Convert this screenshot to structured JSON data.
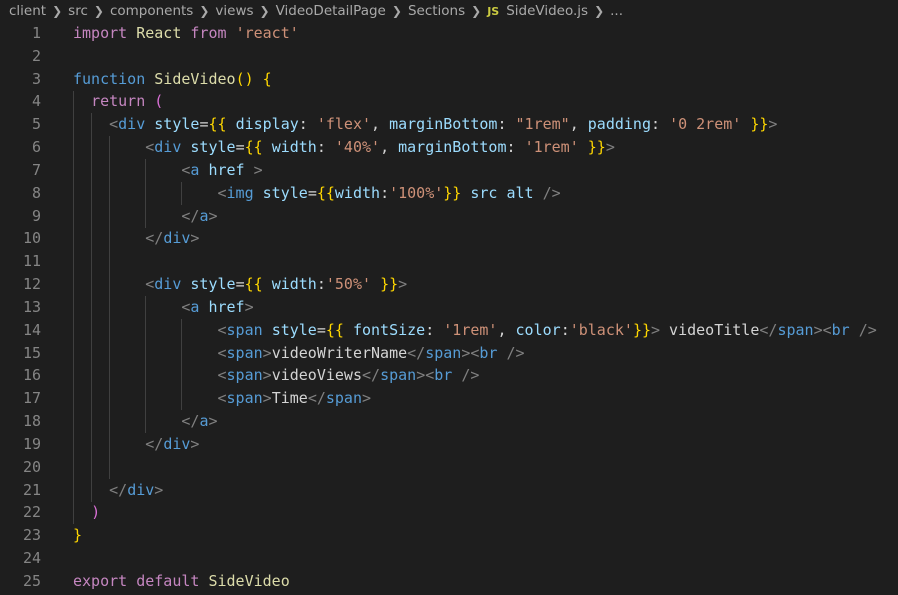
{
  "breadcrumb": {
    "items": [
      "client",
      "src",
      "components",
      "views",
      "VideoDetailPage",
      "Sections"
    ],
    "file_icon": "JS",
    "file_name": "SideVideo.js",
    "ellipsis": "..."
  },
  "code": {
    "line_numbers": [
      "1",
      "2",
      "3",
      "4",
      "5",
      "6",
      "7",
      "8",
      "9",
      "10",
      "11",
      "12",
      "13",
      "14",
      "15",
      "16",
      "17",
      "18",
      "19",
      "20",
      "21",
      "22",
      "23",
      "24",
      "25"
    ],
    "lines": [
      [
        [
          "kw",
          "import"
        ],
        [
          "pl",
          " "
        ],
        [
          "fn",
          "React"
        ],
        [
          "pl",
          " "
        ],
        [
          "kw",
          "from"
        ],
        [
          "pl",
          " "
        ],
        [
          "str",
          "'react'"
        ]
      ],
      [],
      [
        [
          "kwb",
          "function"
        ],
        [
          "pl",
          " "
        ],
        [
          "fn",
          "SideVideo"
        ],
        [
          "cb",
          "()"
        ],
        [
          "pl",
          " "
        ],
        [
          "cb",
          "{"
        ]
      ],
      [
        [
          "pl",
          "  "
        ],
        [
          "kw",
          "return"
        ],
        [
          "pl",
          " "
        ],
        [
          "cb2",
          "("
        ]
      ],
      [
        [
          "pl",
          "    "
        ],
        [
          "br",
          "<"
        ],
        [
          "tag",
          "div"
        ],
        [
          "pl",
          " "
        ],
        [
          "attr",
          "style"
        ],
        [
          "pl",
          "="
        ],
        [
          "cb",
          "{{"
        ],
        [
          "pl",
          " "
        ],
        [
          "attr",
          "display"
        ],
        [
          "pl",
          ": "
        ],
        [
          "str",
          "'flex'"
        ],
        [
          "pl",
          ", "
        ],
        [
          "attr",
          "marginBottom"
        ],
        [
          "pl",
          ": "
        ],
        [
          "str",
          "\"1rem\""
        ],
        [
          "pl",
          ", "
        ],
        [
          "attr",
          "padding"
        ],
        [
          "pl",
          ": "
        ],
        [
          "str",
          "'0 2rem'"
        ],
        [
          "pl",
          " "
        ],
        [
          "cb",
          "}}"
        ],
        [
          "br",
          ">"
        ]
      ],
      [
        [
          "pl",
          "        "
        ],
        [
          "br",
          "<"
        ],
        [
          "tag",
          "div"
        ],
        [
          "pl",
          " "
        ],
        [
          "attr",
          "style"
        ],
        [
          "pl",
          "="
        ],
        [
          "cb",
          "{{"
        ],
        [
          "pl",
          " "
        ],
        [
          "attr",
          "width"
        ],
        [
          "pl",
          ": "
        ],
        [
          "str",
          "'40%'"
        ],
        [
          "pl",
          ", "
        ],
        [
          "attr",
          "marginBottom"
        ],
        [
          "pl",
          ": "
        ],
        [
          "str",
          "'1rem'"
        ],
        [
          "pl",
          " "
        ],
        [
          "cb",
          "}}"
        ],
        [
          "br",
          ">"
        ]
      ],
      [
        [
          "pl",
          "            "
        ],
        [
          "br",
          "<"
        ],
        [
          "tag",
          "a"
        ],
        [
          "pl",
          " "
        ],
        [
          "attr",
          "href"
        ],
        [
          "pl",
          " "
        ],
        [
          "br",
          ">"
        ]
      ],
      [
        [
          "pl",
          "                "
        ],
        [
          "br",
          "<"
        ],
        [
          "tag",
          "img"
        ],
        [
          "pl",
          " "
        ],
        [
          "attr",
          "style"
        ],
        [
          "pl",
          "="
        ],
        [
          "cb",
          "{{"
        ],
        [
          "attr",
          "width"
        ],
        [
          "pl",
          ":"
        ],
        [
          "str",
          "'100%'"
        ],
        [
          "cb",
          "}}"
        ],
        [
          "pl",
          " "
        ],
        [
          "attr",
          "src"
        ],
        [
          "pl",
          " "
        ],
        [
          "attr",
          "alt"
        ],
        [
          "pl",
          " "
        ],
        [
          "br",
          "/>"
        ]
      ],
      [
        [
          "pl",
          "            "
        ],
        [
          "br",
          "</"
        ],
        [
          "tag",
          "a"
        ],
        [
          "br",
          ">"
        ]
      ],
      [
        [
          "pl",
          "        "
        ],
        [
          "br",
          "</"
        ],
        [
          "tag",
          "div"
        ],
        [
          "br",
          ">"
        ]
      ],
      [],
      [
        [
          "pl",
          "        "
        ],
        [
          "br",
          "<"
        ],
        [
          "tag",
          "div"
        ],
        [
          "pl",
          " "
        ],
        [
          "attr",
          "style"
        ],
        [
          "pl",
          "="
        ],
        [
          "cb",
          "{{"
        ],
        [
          "pl",
          " "
        ],
        [
          "attr",
          "width"
        ],
        [
          "pl",
          ":"
        ],
        [
          "str",
          "'50%'"
        ],
        [
          "pl",
          " "
        ],
        [
          "cb",
          "}}"
        ],
        [
          "br",
          ">"
        ]
      ],
      [
        [
          "pl",
          "            "
        ],
        [
          "br",
          "<"
        ],
        [
          "tag",
          "a"
        ],
        [
          "pl",
          " "
        ],
        [
          "attr",
          "href"
        ],
        [
          "br",
          ">"
        ]
      ],
      [
        [
          "pl",
          "                "
        ],
        [
          "br",
          "<"
        ],
        [
          "tag",
          "span"
        ],
        [
          "pl",
          " "
        ],
        [
          "attr",
          "style"
        ],
        [
          "pl",
          "="
        ],
        [
          "cb",
          "{{"
        ],
        [
          "pl",
          " "
        ],
        [
          "attr",
          "fontSize"
        ],
        [
          "pl",
          ": "
        ],
        [
          "str",
          "'1rem'"
        ],
        [
          "pl",
          ", "
        ],
        [
          "attr",
          "color"
        ],
        [
          "pl",
          ":"
        ],
        [
          "str",
          "'black'"
        ],
        [
          "cb",
          "}}"
        ],
        [
          "br",
          ">"
        ],
        [
          "pl",
          " videoTitle"
        ],
        [
          "br",
          "</"
        ],
        [
          "tag",
          "span"
        ],
        [
          "br",
          "><"
        ],
        [
          "tag",
          "br"
        ],
        [
          "pl",
          " "
        ],
        [
          "br",
          "/>"
        ]
      ],
      [
        [
          "pl",
          "                "
        ],
        [
          "br",
          "<"
        ],
        [
          "tag",
          "span"
        ],
        [
          "br",
          ">"
        ],
        [
          "pl",
          "videoWriterName"
        ],
        [
          "br",
          "</"
        ],
        [
          "tag",
          "span"
        ],
        [
          "br",
          "><"
        ],
        [
          "tag",
          "br"
        ],
        [
          "pl",
          " "
        ],
        [
          "br",
          "/>"
        ]
      ],
      [
        [
          "pl",
          "                "
        ],
        [
          "br",
          "<"
        ],
        [
          "tag",
          "span"
        ],
        [
          "br",
          ">"
        ],
        [
          "pl",
          "videoViews"
        ],
        [
          "br",
          "</"
        ],
        [
          "tag",
          "span"
        ],
        [
          "br",
          "><"
        ],
        [
          "tag",
          "br"
        ],
        [
          "pl",
          " "
        ],
        [
          "br",
          "/>"
        ]
      ],
      [
        [
          "pl",
          "                "
        ],
        [
          "br",
          "<"
        ],
        [
          "tag",
          "span"
        ],
        [
          "br",
          ">"
        ],
        [
          "pl",
          "Time"
        ],
        [
          "br",
          "</"
        ],
        [
          "tag",
          "span"
        ],
        [
          "br",
          ">"
        ]
      ],
      [
        [
          "pl",
          "            "
        ],
        [
          "br",
          "</"
        ],
        [
          "tag",
          "a"
        ],
        [
          "br",
          ">"
        ]
      ],
      [
        [
          "pl",
          "        "
        ],
        [
          "br",
          "</"
        ],
        [
          "tag",
          "div"
        ],
        [
          "br",
          ">"
        ]
      ],
      [],
      [
        [
          "pl",
          "    "
        ],
        [
          "br",
          "</"
        ],
        [
          "tag",
          "div"
        ],
        [
          "br",
          ">"
        ]
      ],
      [
        [
          "pl",
          "  "
        ],
        [
          "cb2",
          ")"
        ]
      ],
      [
        [
          "cb",
          "}"
        ]
      ],
      [],
      [
        [
          "kw",
          "export"
        ],
        [
          "pl",
          " "
        ],
        [
          "kw",
          "default"
        ],
        [
          "pl",
          " "
        ],
        [
          "fn",
          "SideVideo"
        ]
      ]
    ]
  },
  "colors": {
    "background": "#1e1e1e",
    "line_number": "#858585",
    "keyword_control": "#c586c0",
    "keyword_storage": "#569cd6",
    "function": "#dcdcaa",
    "string": "#ce9178",
    "tag": "#569cd6",
    "attribute": "#9cdcfe",
    "bracket_gold": "#ffd700",
    "bracket_orchid": "#da70d6"
  }
}
